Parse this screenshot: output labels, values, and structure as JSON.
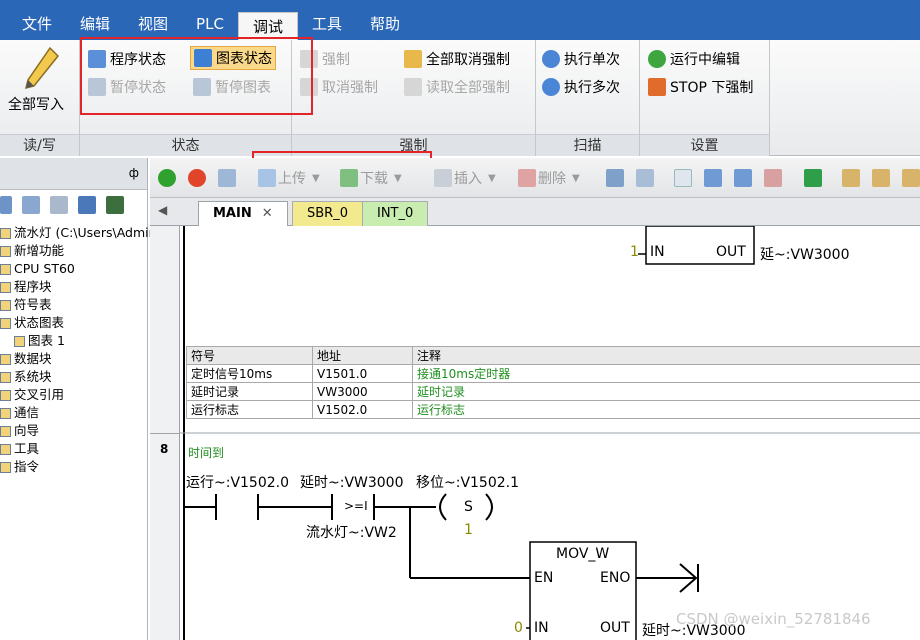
{
  "menu": {
    "items": [
      "文件",
      "编辑",
      "视图",
      "PLC",
      "调试",
      "工具",
      "帮助"
    ],
    "active_index": 4
  },
  "ribbon": {
    "read_write": {
      "write_all": "全部写入",
      "group_label": "读/写"
    },
    "status": {
      "program_status": "程序状态",
      "chart_status": "图表状态",
      "pause_status": "暂停状态",
      "pause_chart": "暂停图表",
      "group_label": "状态"
    },
    "force": {
      "force": "强制",
      "unforce": "取消强制",
      "unforce_all": "全部取消强制",
      "read_all_forced": "读取全部强制",
      "group_label": "强制"
    },
    "scan": {
      "run_single": "执行单次",
      "run_multiple": "执行多次",
      "group_label": "扫描"
    },
    "settings": {
      "run_edit": "运行中编辑",
      "stop_force": "STOP 下强制",
      "group_label": "设置"
    }
  },
  "tree": {
    "pin": "ф",
    "items": [
      {
        "label": "流水灯 (C:\\Users\\Administr",
        "indent": 0
      },
      {
        "label": "新增功能",
        "indent": 0
      },
      {
        "label": "CPU ST60",
        "indent": 0
      },
      {
        "label": "程序块",
        "indent": 0
      },
      {
        "label": "符号表",
        "indent": 0
      },
      {
        "label": "状态图表",
        "indent": 0
      },
      {
        "label": "图表 1",
        "indent": 1
      },
      {
        "label": "数据块",
        "indent": 0
      },
      {
        "label": "系统块",
        "indent": 0
      },
      {
        "label": "交叉引用",
        "indent": 0
      },
      {
        "label": "通信",
        "indent": 0
      },
      {
        "label": "向导",
        "indent": 0
      },
      {
        "label": "工具",
        "indent": 0
      },
      {
        "label": "指令",
        "indent": 0
      }
    ]
  },
  "editor_toolbar": {
    "upload": "上传",
    "download": "下载",
    "insert": "插入",
    "delete": "删除"
  },
  "tabs": [
    "MAIN",
    "SBR_0",
    "INT_0"
  ],
  "ladder": {
    "top_block": {
      "in_value": "1",
      "in_pin": "IN",
      "out_pin": "OUT",
      "out_operand": "延~:VW3000"
    },
    "symbol_table": {
      "headers": [
        "符号",
        "地址",
        "注释"
      ],
      "rows": [
        [
          "定时信号10ms",
          "V1501.0",
          "接通10ms定时器"
        ],
        [
          "延时记录",
          "VW3000",
          "延时记录"
        ],
        [
          "运行标志",
          "V1502.0",
          "运行标志"
        ]
      ]
    },
    "network": {
      "number": "8",
      "comment": "时间到",
      "contact1": "运行~:V1502.0",
      "contact2": "延时~:VW3000",
      "compare_op": ">=I",
      "compare_operand": "流水灯~:VW2",
      "coil_operand": "移位~:V1502.1",
      "coil_type": "S",
      "coil_count": "1",
      "mov_block": {
        "title": "MOV_W",
        "en": "EN",
        "eno": "ENO",
        "in_pin": "IN",
        "out_pin": "OUT",
        "in_value": "0",
        "out_operand": "延时~:VW3000"
      }
    }
  },
  "watermark": "CSDN @weixin_52781846",
  "colors": {
    "menubar": "#2a67b6",
    "highlight_box": "#e3252a",
    "comment_green": "#1f8f1f",
    "pressed": "#fbd98a"
  }
}
